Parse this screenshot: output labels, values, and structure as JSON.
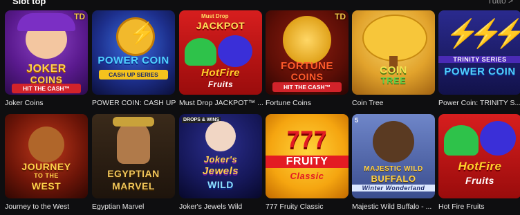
{
  "header": {
    "title": "Slot top",
    "see_all": "Tutto >"
  },
  "games": [
    {
      "name": "Joker Coins",
      "badge": "TD",
      "art": {
        "line1": "JOKER",
        "line2": "COINS",
        "strip": "HIT THE CASH™"
      }
    },
    {
      "name": "POWER COIN: CASH UP",
      "art": {
        "line1": "POWER COIN",
        "strip": "CASH UP SERIES"
      }
    },
    {
      "name": "Must Drop JACKPOT™ ...",
      "art": {
        "tag": "Must Drop",
        "line1": "JACKPOT",
        "line2": "HotFire",
        "line3": "Fruits"
      }
    },
    {
      "name": "Fortune Coins",
      "badge": "TD",
      "art": {
        "line1": "FORTUNE",
        "line2": "COINS",
        "strip": "HIT THE CASH™"
      }
    },
    {
      "name": "Coin Tree",
      "art": {
        "line1": "COIN",
        "line2": "TREE"
      }
    },
    {
      "name": "Power Coin: TRINITY S...",
      "art": {
        "tag": "TRINITY SERIES",
        "line1": "POWER COIN"
      }
    },
    {
      "name": "Journey to the West",
      "art": {
        "line1": "JOURNEY",
        "line2": "TO THE",
        "line3": "WEST"
      }
    },
    {
      "name": "Egyptian Marvel",
      "art": {
        "line1": "EGYPTIAN",
        "line2": "MARVEL"
      }
    },
    {
      "name": "Joker's Jewels Wild",
      "art": {
        "tag": "DROPS & WINS",
        "line1": "Joker's",
        "line2": "Jewels",
        "line3": "WILD"
      }
    },
    {
      "name": "777 Fruity Classic",
      "art": {
        "line1": "777",
        "line2": "FRUITY",
        "line3": "Classic"
      }
    },
    {
      "name": "Majestic Wild Buffalo - ...",
      "art": {
        "tag": "5",
        "line1": "MAJESTIC WILD",
        "line2": "BUFFALO",
        "line3": "Winter Wonderland"
      }
    },
    {
      "name": "Hot Fire Fruits",
      "art": {
        "line1": "HotFire",
        "line2": "Fruits"
      }
    }
  ],
  "colors": {
    "background": "#0e0e10",
    "label": "#e6e6e6",
    "badge": "#f7c948"
  }
}
